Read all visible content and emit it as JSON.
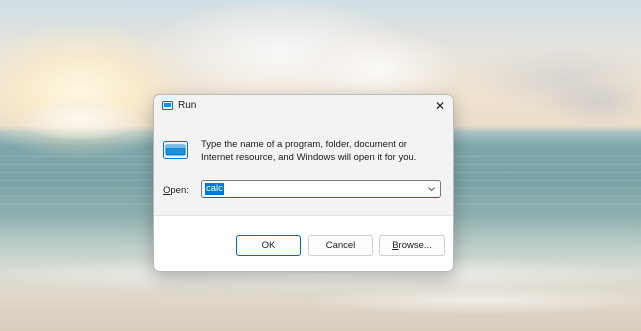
{
  "window": {
    "title": "Run",
    "close_glyph": "✕"
  },
  "dialog": {
    "description": "Type the name of a program, folder, document or Internet resource, and Windows will open it for you.",
    "open_label_accel": "O",
    "open_label_rest": "pen:",
    "open_value": "calc"
  },
  "buttons": {
    "ok": "OK",
    "cancel": "Cancel",
    "browse_accel": "B",
    "browse_rest": "rowse..."
  },
  "icons": {
    "app": "run-icon",
    "big": "run-program-icon",
    "dropdown": "chevron-down-icon",
    "close": "close-icon"
  },
  "colors": {
    "accent": "#0078d4",
    "dialog_bg": "#f3f3f3",
    "button_area_bg": "#ffffff"
  }
}
